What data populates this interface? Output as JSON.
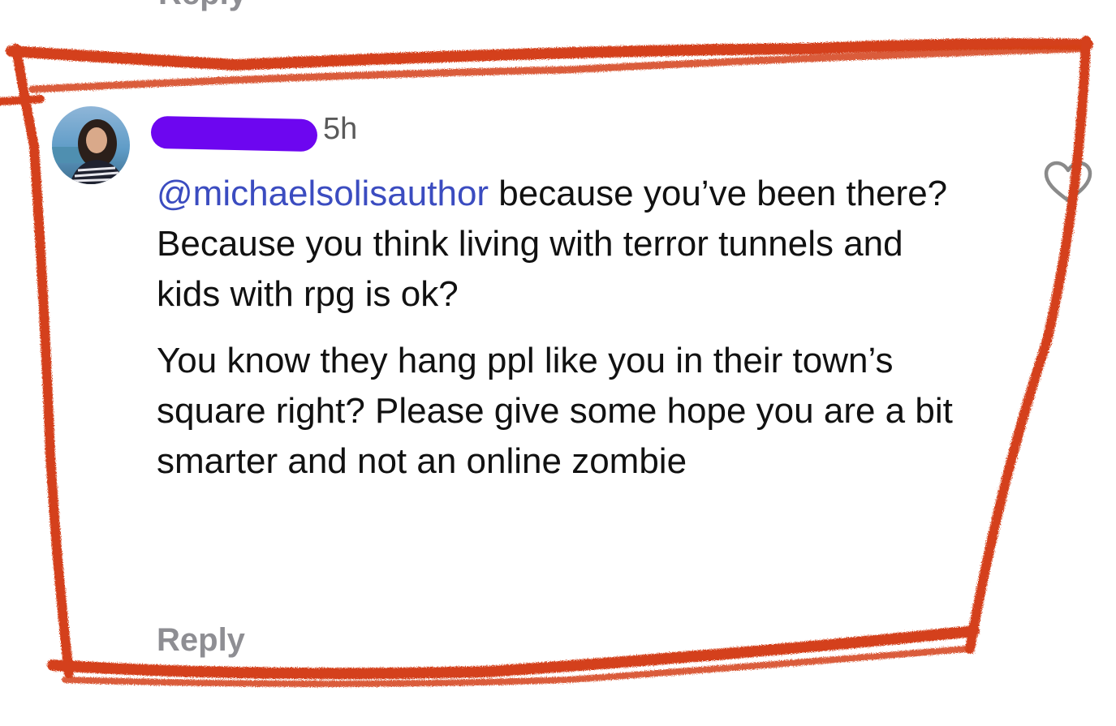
{
  "previous_comment": {
    "reply_label": "Reply"
  },
  "comment": {
    "timestamp": "5h",
    "mention": "@michaelsolisauthor",
    "paragraph_1_rest": " because you’ve been there? Because you think living with terror tunnels and kids with rpg is ok?",
    "paragraph_2": "You know they hang ppl like you in their town’s square right? Please give some hope you are a bit smarter and not an online zombie",
    "reply_label": "Reply",
    "like_icon": "heart-outline-icon"
  },
  "colors": {
    "mention": "#3b4cc0",
    "redaction": "#6d06f0",
    "annotation": "#d4411a",
    "muted": "#8e8e93"
  }
}
